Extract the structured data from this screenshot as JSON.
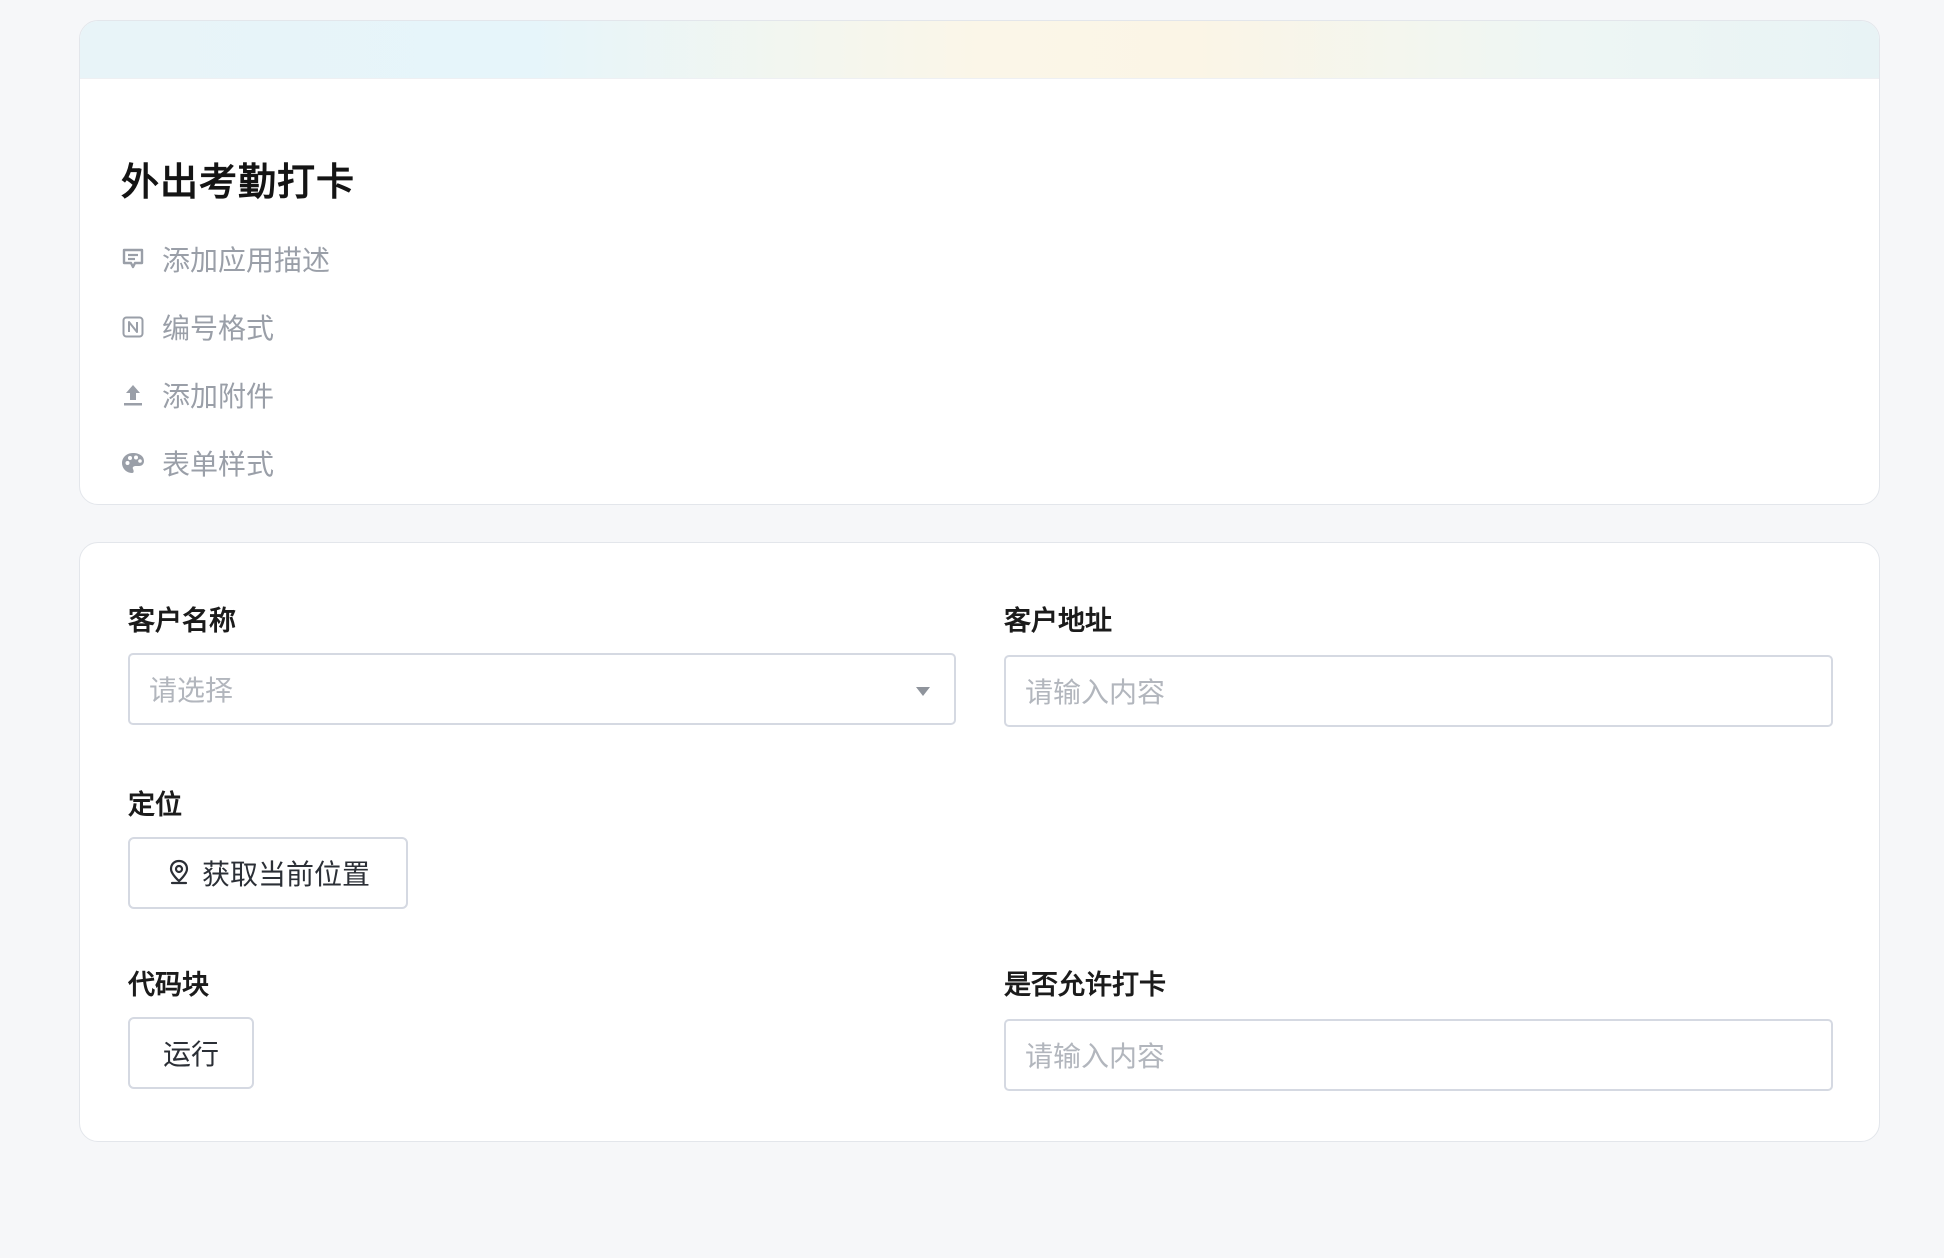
{
  "app": {
    "title": "外出考勤打卡"
  },
  "meta_items": [
    {
      "label": "添加应用描述",
      "icon": "comment-icon"
    },
    {
      "label": "编号格式",
      "icon": "number-format-icon"
    },
    {
      "label": "添加附件",
      "icon": "upload-icon"
    },
    {
      "label": "表单样式",
      "icon": "palette-icon"
    }
  ],
  "form": {
    "customer_name": {
      "label": "客户名称",
      "placeholder": "请选择"
    },
    "customer_address": {
      "label": "客户地址",
      "placeholder": "请输入内容"
    },
    "location": {
      "label": "定位",
      "button_label": "获取当前位置",
      "icon": "location-pin-icon"
    },
    "code_block": {
      "label": "代码块",
      "button_label": "运行"
    },
    "allow_checkin": {
      "label": "是否允许打卡",
      "placeholder": "请输入内容"
    }
  },
  "colors": {
    "background": "#f6f7f9",
    "card_border": "#e3e6eb",
    "placeholder": "#b2b6bd",
    "meta_text": "#9a9fa8"
  }
}
